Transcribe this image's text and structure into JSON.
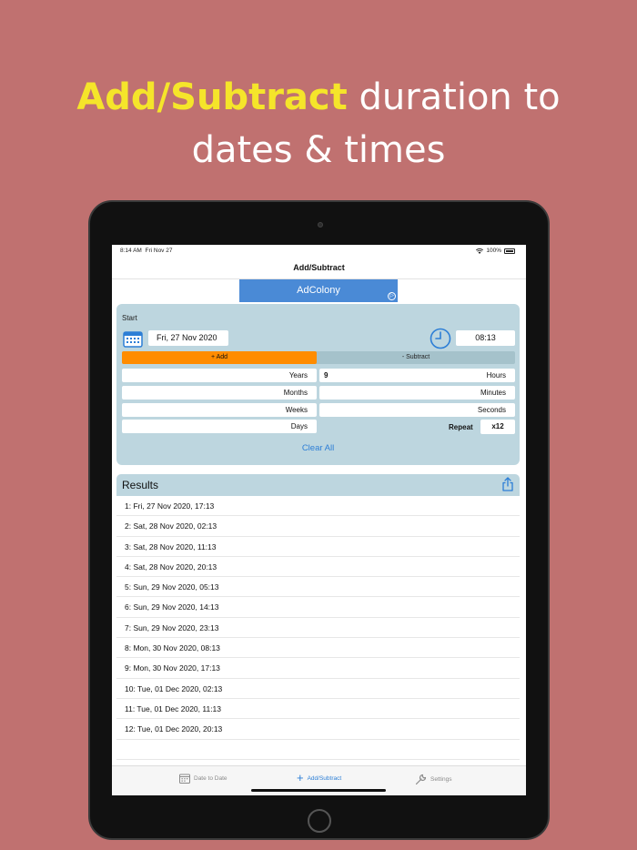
{
  "promo": {
    "headline_accent": "Add/Subtract",
    "headline_rest_line1": " duration to",
    "headline_line2": "dates & times"
  },
  "status_bar": {
    "time": "8:14 AM",
    "date": "Fri Nov 27",
    "battery": "100%"
  },
  "nav": {
    "title": "Add/Subtract"
  },
  "ad": {
    "label": "AdColony",
    "choice_glyph": "▷"
  },
  "form": {
    "start_label": "Start",
    "date_value": "Fri, 27 Nov 2020",
    "time_value": "08:13",
    "mode": {
      "add_label": "+ Add",
      "subtract_label": "- Subtract",
      "selected": "add"
    },
    "fields": {
      "years": {
        "label": "Years",
        "value": ""
      },
      "months": {
        "label": "Months",
        "value": ""
      },
      "weeks": {
        "label": "Weeks",
        "value": ""
      },
      "days": {
        "label": "Days",
        "value": ""
      },
      "hours": {
        "label": "Hours",
        "value": "9"
      },
      "minutes": {
        "label": "Minutes",
        "value": ""
      },
      "seconds": {
        "label": "Seconds",
        "value": ""
      }
    },
    "repeat_label": "Repeat",
    "repeat_value": "x12",
    "clear_all_label": "Clear All"
  },
  "results": {
    "title": "Results",
    "items": [
      "1: Fri, 27 Nov 2020, 17:13",
      "2: Sat, 28 Nov 2020, 02:13",
      "3: Sat, 28 Nov 2020, 11:13",
      "4: Sat, 28 Nov 2020, 20:13",
      "5: Sun, 29 Nov 2020, 05:13",
      "6: Sun, 29 Nov 2020, 14:13",
      "7: Sun, 29 Nov 2020, 23:13",
      "8: Mon, 30 Nov 2020, 08:13",
      "9: Mon, 30 Nov 2020, 17:13",
      "10: Tue, 01 Dec 2020, 02:13",
      "11: Tue, 01 Dec 2020, 11:13",
      "12: Tue, 01 Dec 2020, 20:13"
    ]
  },
  "tabs": [
    {
      "label": "Date to Date",
      "icon": "calendar-icon",
      "active": false
    },
    {
      "label": "Add/Subtract",
      "icon": "plus-icon",
      "active": true
    },
    {
      "label": "Settings",
      "icon": "wrench-icon",
      "active": false
    }
  ],
  "colors": {
    "background": "#c07170",
    "accent_yellow": "#f5e52a",
    "panel": "#bdd6df",
    "add_orange": "#ff8c00",
    "link_blue": "#2c7ed6",
    "ad_blue": "#4a8ad6"
  }
}
